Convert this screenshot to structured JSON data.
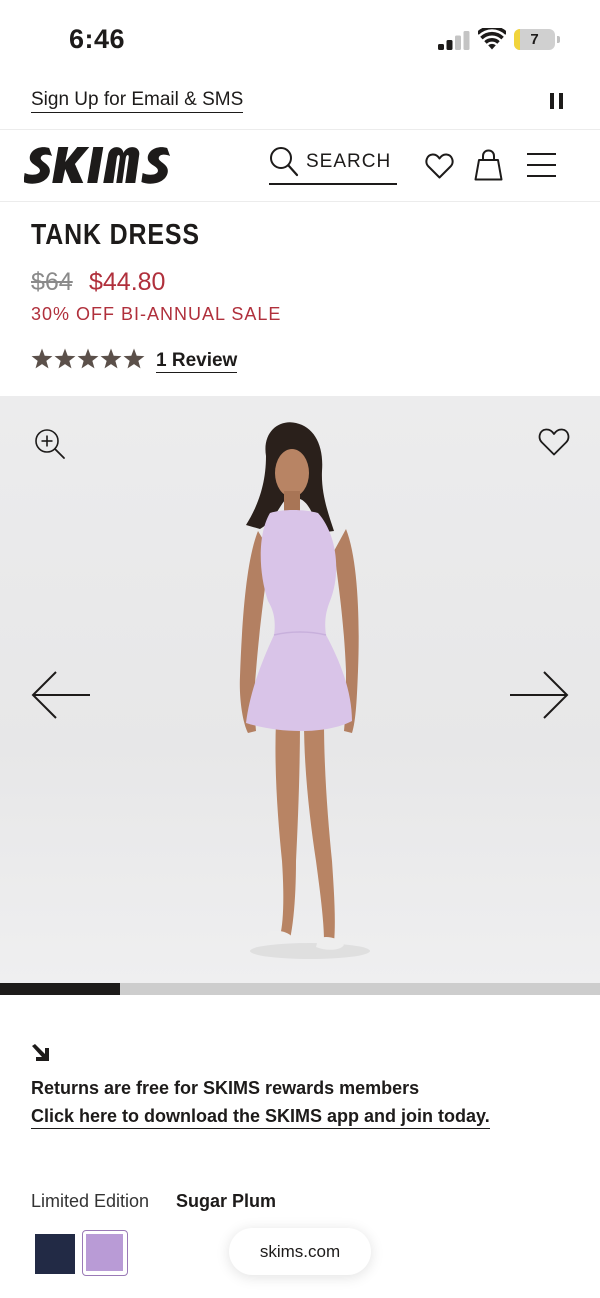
{
  "status_bar": {
    "time": "6:46",
    "battery_level": "7",
    "battery_fraction": 0.07,
    "signal_bars_active": 2,
    "signal_bars_total": 4
  },
  "promo": {
    "signup_link": "Sign Up for Email & SMS"
  },
  "header": {
    "search_label": "SEARCH"
  },
  "product": {
    "title": "TANK DRESS",
    "original_price": "$64",
    "sale_price": "$44.80",
    "sale_label": "30% OFF BI-ANNUAL SALE",
    "rating_stars": 5,
    "rating_max": 5,
    "review_link": "1 Review"
  },
  "gallery": {
    "progress_fraction": 0.2
  },
  "returns": {
    "text": "Returns are free for SKIMS rewards members",
    "link": "Click here to download the SKIMS app and join today."
  },
  "colors": {
    "label": "Limited Edition",
    "selected": "Sugar Plum",
    "swatches": [
      {
        "name": "navy",
        "hex": "#222a45"
      },
      {
        "name": "sugar-plum",
        "hex": "#b99bd6"
      }
    ]
  },
  "browser": {
    "url": "skims.com"
  },
  "theme": {
    "sale_color": "#b0303c",
    "text_color": "#1d1b1a"
  }
}
